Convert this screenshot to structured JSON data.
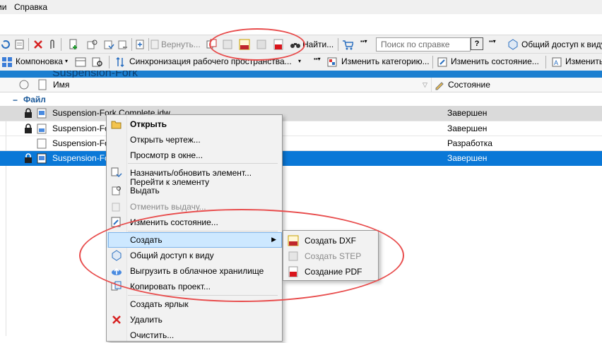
{
  "menubar": {
    "items": [
      "ии",
      "Справка"
    ]
  },
  "toolbar1": {
    "revert_label": "Вернуть...",
    "find_label": "Найти...",
    "search_placeholder": "Поиск по справке",
    "help_label": "?",
    "share_label": "Общий доступ к виду"
  },
  "toolbar2": {
    "layout_label": "Компоновка",
    "sync_label": "Синхронизация рабочего пространства...",
    "change_category_label": "Изменить категорию...",
    "change_state_label": "Изменить состояние...",
    "change_more_label": "Изменить"
  },
  "banner": {
    "title": "Suspension-Fork"
  },
  "table": {
    "columns": {
      "name": "Имя",
      "state": "Состояние"
    },
    "group_label": "Файл",
    "rows": [
      {
        "name": "Suspension-Fork Complete.idw",
        "state": "Завершен",
        "locked": true
      },
      {
        "name": "Suspension-Fo",
        "state": "Завершен",
        "locked": true
      },
      {
        "name": "Suspension-Fo",
        "state": "Разработка",
        "locked": false
      },
      {
        "name": "Suspension-Fo",
        "state": "Завершен",
        "locked": true
      }
    ]
  },
  "context_menu": {
    "open": "Открыть",
    "open_drawing": "Открыть чертеж...",
    "preview": "Просмотр в окне...",
    "assign_item": "Назначить/обновить элемент...",
    "goto_item": "Перейти к элементу",
    "checkout": "Выдать",
    "undo_checkout": "Отменить выдачу...",
    "change_state": "Изменить состояние...",
    "create": "Создать",
    "share_view": "Общий доступ к виду",
    "upload_cloud": "Выгрузить в облачное хранилище",
    "copy_project": "Копировать проект...",
    "create_shortcut": "Создать ярлык",
    "delete": "Удалить",
    "clear": "Очистить..."
  },
  "submenu": {
    "create_dxf": "Создать DXF",
    "create_step": "Создать STEP",
    "create_pdf": "Создание PDF"
  },
  "colors": {
    "accent": "#0a78d7",
    "annotation": "#e84c4c",
    "group": "#1c5a9a"
  }
}
